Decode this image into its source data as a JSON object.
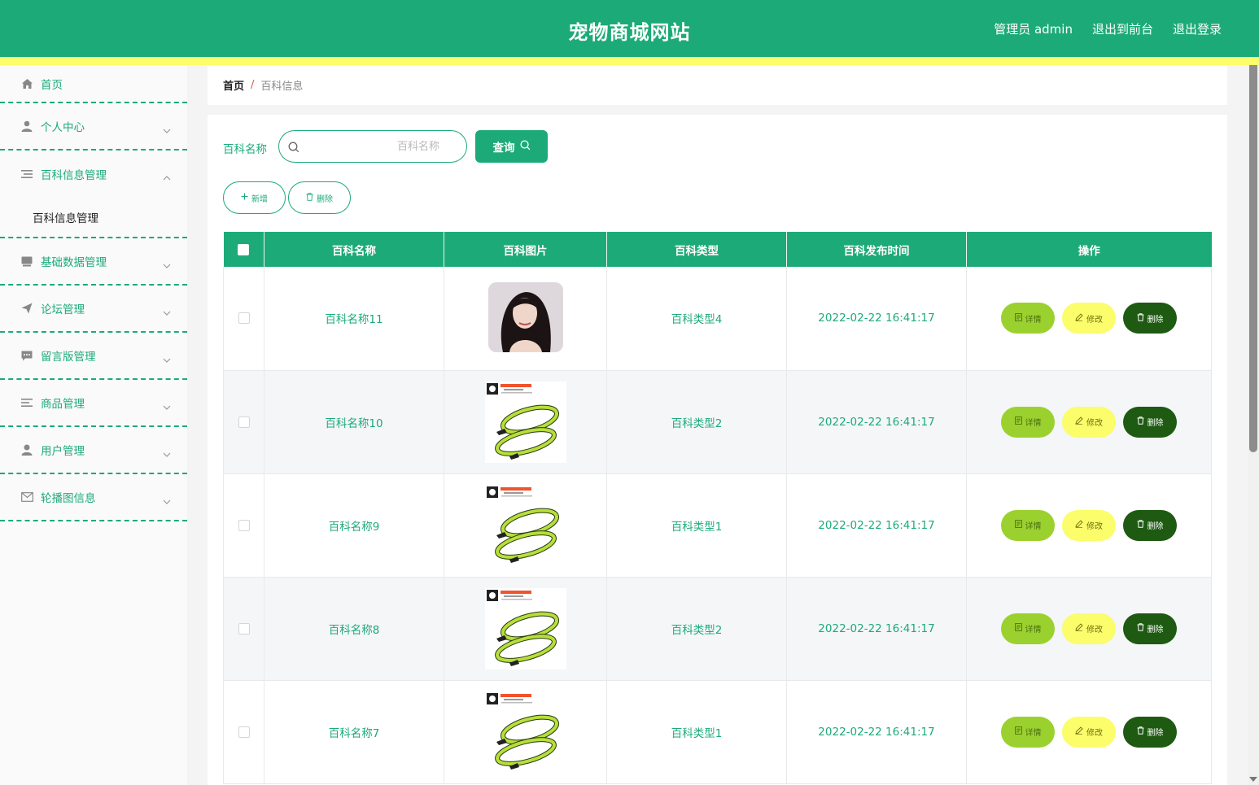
{
  "header": {
    "title": "宠物商城网站",
    "admin_label": "管理员 admin",
    "front_label": "退出到前台",
    "logout_label": "退出登录"
  },
  "sidebar": {
    "items": [
      {
        "label": "首页",
        "icon": "home-icon"
      },
      {
        "label": "个人中心",
        "icon": "user-icon"
      },
      {
        "label": "百科信息管理",
        "icon": "list-icon",
        "expanded": true
      },
      {
        "label": "基础数据管理",
        "icon": "box-icon"
      },
      {
        "label": "论坛管理",
        "icon": "send-icon"
      },
      {
        "label": "留言版管理",
        "icon": "message-icon"
      },
      {
        "label": "商品管理",
        "icon": "menu-lines-icon"
      },
      {
        "label": "用户管理",
        "icon": "person-icon"
      },
      {
        "label": "轮播图信息",
        "icon": "mail-icon"
      }
    ],
    "submenu_label": "百科信息管理"
  },
  "breadcrumb": {
    "home": "首页",
    "separator": "/",
    "current": "百科信息"
  },
  "search": {
    "label": "百科名称",
    "placeholder": "百科名称",
    "button": "查询"
  },
  "toolbar": {
    "add": "新增",
    "delete": "删除"
  },
  "table": {
    "headers": [
      "百科名称",
      "百科图片",
      "百科类型",
      "百科发布时间",
      "操作"
    ],
    "rows": [
      {
        "name": "百科名称11",
        "type": "百科类型4",
        "time": "2022-02-22 16:41:17",
        "image": "portrait-pillow"
      },
      {
        "name": "百科名称10",
        "type": "百科类型2",
        "time": "2022-02-22 16:41:17",
        "image": "green-leash"
      },
      {
        "name": "百科名称9",
        "type": "百科类型1",
        "time": "2022-02-22 16:41:17",
        "image": "green-leash"
      },
      {
        "name": "百科名称8",
        "type": "百科类型2",
        "time": "2022-02-22 16:41:17",
        "image": "green-leash"
      },
      {
        "name": "百科名称7",
        "type": "百科类型1",
        "time": "2022-02-22 16:41:17",
        "image": "green-leash"
      }
    ],
    "actions": {
      "detail": "详情",
      "edit": "修改",
      "remove": "删除"
    }
  },
  "colors": {
    "primary": "#1daa79",
    "accent_yellow": "#fbfd6b",
    "detail_green": "#9bd12e",
    "delete_dark": "#1e5a12"
  }
}
